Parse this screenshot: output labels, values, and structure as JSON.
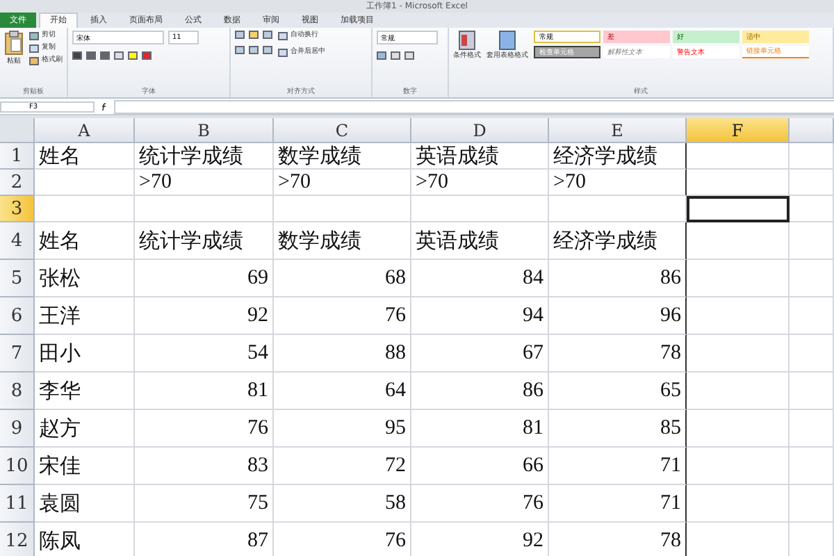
{
  "window": {
    "title": "工作簿1 - Microsoft Excel"
  },
  "tabs": [
    {
      "label": "文件",
      "kind": "file",
      "selected": false
    },
    {
      "label": "开始",
      "kind": "tab",
      "selected": true
    },
    {
      "label": "插入",
      "kind": "tab",
      "selected": false
    },
    {
      "label": "页面布局",
      "kind": "tab",
      "selected": false
    },
    {
      "label": "公式",
      "kind": "tab",
      "selected": false
    },
    {
      "label": "数据",
      "kind": "tab",
      "selected": false
    },
    {
      "label": "审阅",
      "kind": "tab",
      "selected": false
    },
    {
      "label": "视图",
      "kind": "tab",
      "selected": false
    },
    {
      "label": "加载项目",
      "kind": "tab",
      "selected": false
    }
  ],
  "ribbon": {
    "clipboard": {
      "label": "剪贴板",
      "paste": "粘贴",
      "cut": "剪切",
      "copy": "复制",
      "format_painter": "格式刷"
    },
    "font": {
      "label": "字体",
      "name": "宋体",
      "size": "11"
    },
    "alignment": {
      "label": "对齐方式",
      "wrap": "自动换行",
      "merge": "合并后居中"
    },
    "number": {
      "label": "数字",
      "format": "常规"
    },
    "styles": {
      "label": "样式",
      "conditional": "条件格式",
      "table": "套用表格格式",
      "cell_styles": [
        {
          "label": "常规",
          "kind": "normal"
        },
        {
          "label": "差",
          "kind": "bad"
        },
        {
          "label": "好",
          "kind": "good"
        },
        {
          "label": "适中",
          "kind": "neutral"
        },
        {
          "label": "检查单元格",
          "kind": "check"
        },
        {
          "label": "解释性文本",
          "kind": "explanatory"
        },
        {
          "label": "警告文本",
          "kind": "warning"
        },
        {
          "label": "链接单元格",
          "kind": "linked"
        }
      ]
    }
  },
  "formula_bar": {
    "name_box": "F3"
  },
  "columns": [
    {
      "label": "A",
      "selected": false
    },
    {
      "label": "B",
      "selected": false
    },
    {
      "label": "C",
      "selected": false
    },
    {
      "label": "D",
      "selected": false
    },
    {
      "label": "E",
      "selected": false
    },
    {
      "label": "F",
      "selected": true
    }
  ],
  "rows": [
    {
      "number": "1",
      "kind": "header",
      "selected": false,
      "cells": [
        "姓名",
        "统计学成绩",
        "数学成绩",
        "英语成绩",
        "经济学成绩"
      ]
    },
    {
      "number": "2",
      "kind": "header",
      "selected": false,
      "cells": [
        null,
        ">70",
        ">70",
        ">70",
        ">70"
      ]
    },
    {
      "number": "3",
      "kind": "header",
      "selected": true
    },
    {
      "number": "4",
      "kind": "header",
      "selected": false,
      "cells": [
        "姓名",
        "统计学成绩",
        "数学成绩",
        "英语成绩",
        "经济学成绩"
      ]
    },
    {
      "number": "5",
      "kind": "data",
      "selected": false,
      "cells": [
        "张松",
        "69",
        "68",
        "84",
        "86"
      ]
    },
    {
      "number": "6",
      "kind": "data",
      "selected": false,
      "cells": [
        "王洋",
        "92",
        "76",
        "94",
        "96"
      ]
    },
    {
      "number": "7",
      "kind": "data",
      "selected": false,
      "cells": [
        "田小",
        "54",
        "88",
        "67",
        "78"
      ]
    },
    {
      "number": "8",
      "kind": "data",
      "selected": false,
      "cells": [
        "李华",
        "81",
        "64",
        "86",
        "65"
      ]
    },
    {
      "number": "9",
      "kind": "data",
      "selected": false,
      "cells": [
        "赵方",
        "76",
        "95",
        "81",
        "85"
      ]
    },
    {
      "number": "10",
      "kind": "data",
      "selected": false,
      "cells": [
        "宋佳",
        "83",
        "72",
        "66",
        "71"
      ]
    },
    {
      "number": "11",
      "kind": "data",
      "selected": false,
      "cells": [
        "袁圆",
        "75",
        "58",
        "76",
        "71"
      ]
    },
    {
      "number": "12",
      "kind": "data",
      "selected": false,
      "cells": [
        "陈凤",
        "87",
        "76",
        "92",
        "78"
      ]
    }
  ]
}
